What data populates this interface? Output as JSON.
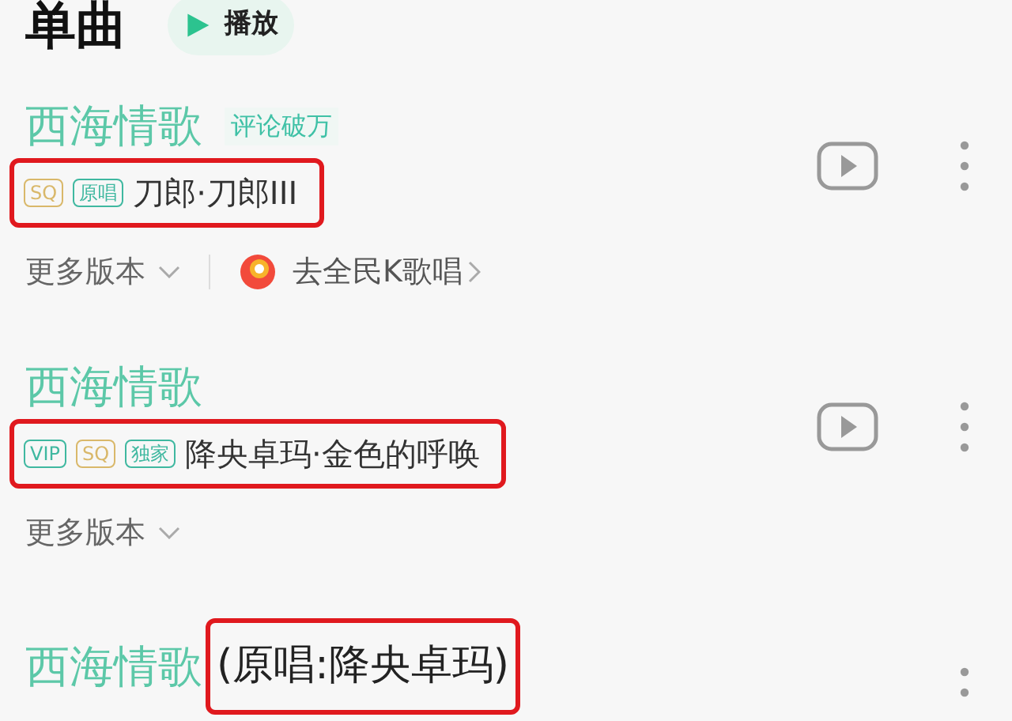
{
  "header": {
    "title": "单曲",
    "play_button": "播放"
  },
  "songs": [
    {
      "title": "西海情歌",
      "badge": "评论破万",
      "tags": [
        {
          "label": "SQ",
          "color": "#d9b86a"
        },
        {
          "label": "原唱",
          "color": "#3fb8a0"
        }
      ],
      "subtitle": "刀郎·刀郎III",
      "subtitle_highlighted": true,
      "video": true,
      "more_versions": "更多版本",
      "karaoke_link": "去全民K歌唱"
    },
    {
      "title": "西海情歌",
      "tags": [
        {
          "label": "VIP",
          "color": "#3fb8a0"
        },
        {
          "label": "SQ",
          "color": "#d9b86a"
        },
        {
          "label": "独家",
          "color": "#3fb8a0"
        }
      ],
      "subtitle": "降央卓玛·金色的呼唤",
      "subtitle_highlighted": true,
      "video": true,
      "more_versions": "更多版本"
    },
    {
      "title": "西海情歌",
      "title_suffix": "(原唱:降央卓玛)",
      "suffix_highlighted": true,
      "video": false
    }
  ]
}
